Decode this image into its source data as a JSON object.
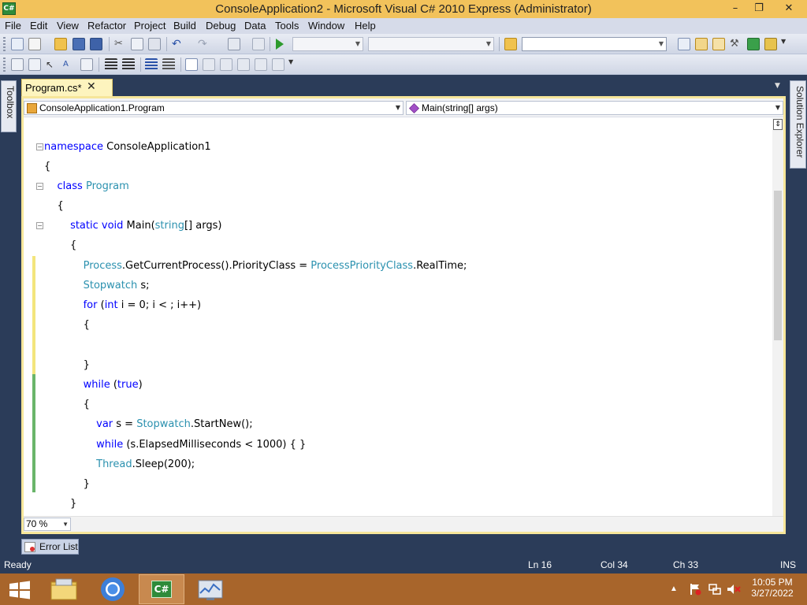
{
  "window": {
    "title": "ConsoleApplication2 - Microsoft Visual C# 2010 Express (Administrator)",
    "app_icon_text": "C#",
    "minimize": "–",
    "restore": "❐",
    "close": "✕"
  },
  "menu": [
    "File",
    "Edit",
    "View",
    "Refactor",
    "Project",
    "Build",
    "Debug",
    "Data",
    "Tools",
    "Window",
    "Help"
  ],
  "side_panels": {
    "toolbox": "Toolbox",
    "solution_explorer": "Solution Explorer"
  },
  "editor": {
    "tab_label": "Program.cs*",
    "tab_close": "✕",
    "nav_class": "ConsoleApplication1.Program",
    "nav_member": "Main(string[] args)",
    "zoom": "70 %"
  },
  "code_lines": [
    {
      "kw1": "namespace",
      "plain1": " ConsoleApplication1"
    },
    {
      "plain1": "{"
    },
    {
      "plain1": "    ",
      "kw1": "class",
      "plain2": " ",
      "ty1": "Program"
    },
    {
      "plain1": "    {"
    },
    {
      "plain1": "        ",
      "kw1": "static void",
      "plain2": " Main(",
      "kw2": "string",
      "plain3": "[] args)"
    },
    {
      "plain1": "        {"
    },
    {
      "plain1": "            ",
      "ty1": "Process",
      "plain2": ".GetCurrentProcess().PriorityClass = ",
      "ty2": "ProcessPriorityClass",
      "plain3": ".RealTime;"
    },
    {
      "plain1": "            ",
      "ty1": "Stopwatch",
      "plain2": " s;"
    },
    {
      "plain1": "            ",
      "kw1": "for",
      "plain2": " (",
      "kw2": "int",
      "plain3": " i = 0; i < ; i++)"
    },
    {
      "plain1": "            {"
    },
    {
      "plain1": ""
    },
    {
      "plain1": "            }"
    },
    {
      "plain1": "            ",
      "kw1": "while",
      "plain2": " (",
      "kw2": "true",
      "plain3": ")"
    },
    {
      "plain1": "            {"
    },
    {
      "plain1": "                ",
      "kw1": "var",
      "plain2": " s = ",
      "ty1": "Stopwatch",
      "plain3": ".StartNew();"
    },
    {
      "plain1": "                ",
      "kw1": "while",
      "plain2": " (s.ElapsedMilliseconds < 1000) { }"
    },
    {
      "plain1": "                ",
      "ty1": "Thread",
      "plain2": ".Sleep(200);"
    },
    {
      "plain1": "            }"
    },
    {
      "plain1": "        }"
    }
  ],
  "error_list": "Error List",
  "status": {
    "ready": "Ready",
    "line": "Ln 16",
    "col": "Col 34",
    "ch": "Ch 33",
    "mode": "INS"
  },
  "taskbar": {
    "time": "10:05 PM",
    "date": "3/27/2022",
    "vs_icon_text": "C#"
  }
}
